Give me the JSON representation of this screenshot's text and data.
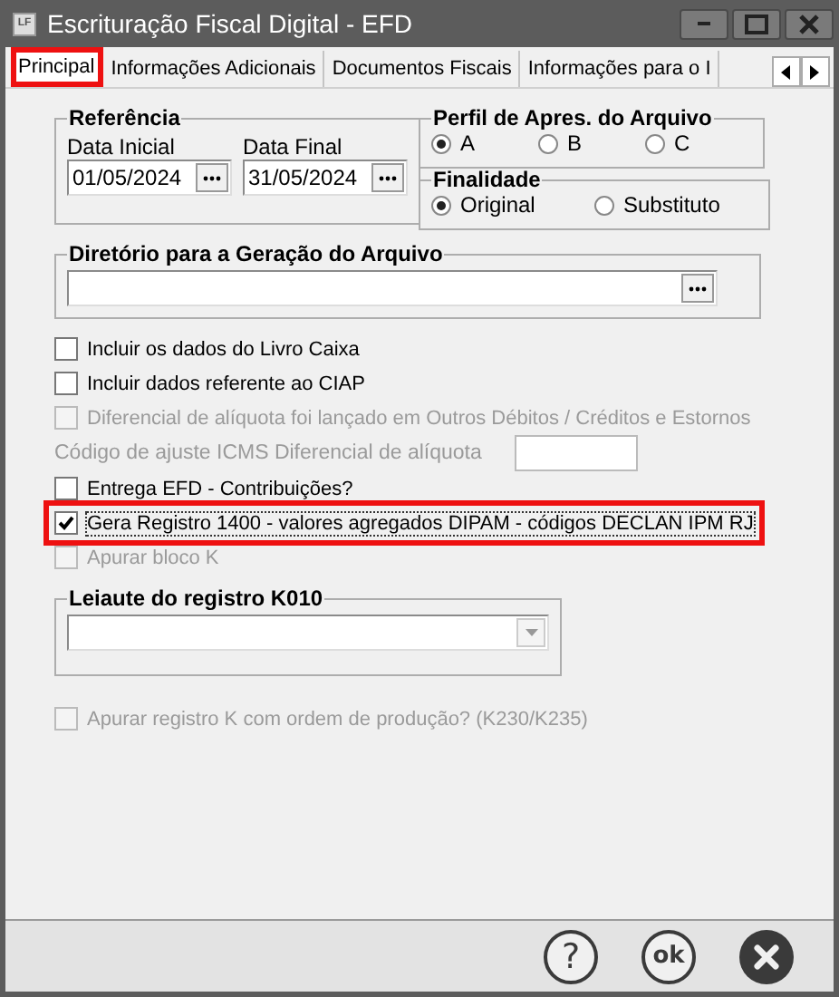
{
  "window": {
    "title": "Escrituração Fiscal Digital - EFD",
    "icon": "LF"
  },
  "tabs": [
    {
      "label": "Principal",
      "selected": true,
      "highlighted": true
    },
    {
      "label": "Informações Adicionais",
      "selected": false,
      "highlighted": false
    },
    {
      "label": "Documentos Fiscais",
      "selected": false,
      "highlighted": false
    },
    {
      "label": "Informações para o I",
      "selected": false,
      "highlighted": false
    }
  ],
  "referencia": {
    "title": "Referência",
    "start_label": "Data Inicial",
    "start_value": "01/05/2024",
    "end_label": "Data Final",
    "end_value": "31/05/2024"
  },
  "perfil": {
    "title": "Perfil de Apres. do Arquivo",
    "options": [
      {
        "label": "A",
        "selected": true
      },
      {
        "label": "B",
        "selected": false
      },
      {
        "label": "C",
        "selected": false
      }
    ]
  },
  "finalidade": {
    "title": "Finalidade",
    "options": [
      {
        "label": "Original",
        "selected": true
      },
      {
        "label": "Substituto",
        "selected": false
      }
    ]
  },
  "diretorio": {
    "title": "Diretório para a Geração do Arquivo"
  },
  "options": [
    {
      "kind": "checkbox",
      "label": "Incluir os dados do Livro Caixa",
      "checked": false,
      "disabled": false,
      "highlighted": false
    },
    {
      "kind": "checkbox",
      "label": "Incluir dados referente ao CIAP",
      "checked": false,
      "disabled": false,
      "highlighted": false
    },
    {
      "kind": "checkbox",
      "label": "Diferencial de alíquota foi lançado em Outros Débitos / Créditos e Estornos",
      "checked": false,
      "disabled": true,
      "highlighted": false
    },
    {
      "kind": "field",
      "label": "Código de ajuste ICMS Diferencial de alíquota",
      "disabled": true
    },
    {
      "kind": "checkbox",
      "label": "Entrega EFD - Contribuições?",
      "checked": false,
      "disabled": false,
      "highlighted": false
    },
    {
      "kind": "checkbox",
      "label": "Gera Registro 1400 - valores agregados DIPAM - códigos DECLAN IPM RJ",
      "checked": true,
      "disabled": false,
      "highlighted": true
    },
    {
      "kind": "checkbox",
      "label": "Apurar bloco K",
      "checked": false,
      "disabled": true,
      "highlighted": false
    }
  ],
  "leiaute": {
    "title": "Leiaute do registro K010"
  },
  "options_after": [
    {
      "kind": "checkbox",
      "label": "Apurar registro K com ordem de produção? (K230/K235)",
      "checked": false,
      "disabled": true,
      "highlighted": false
    }
  ],
  "buttons": [
    {
      "kind": "help",
      "label": "?"
    },
    {
      "kind": "ok",
      "label": "ok"
    },
    {
      "kind": "cancel"
    }
  ]
}
